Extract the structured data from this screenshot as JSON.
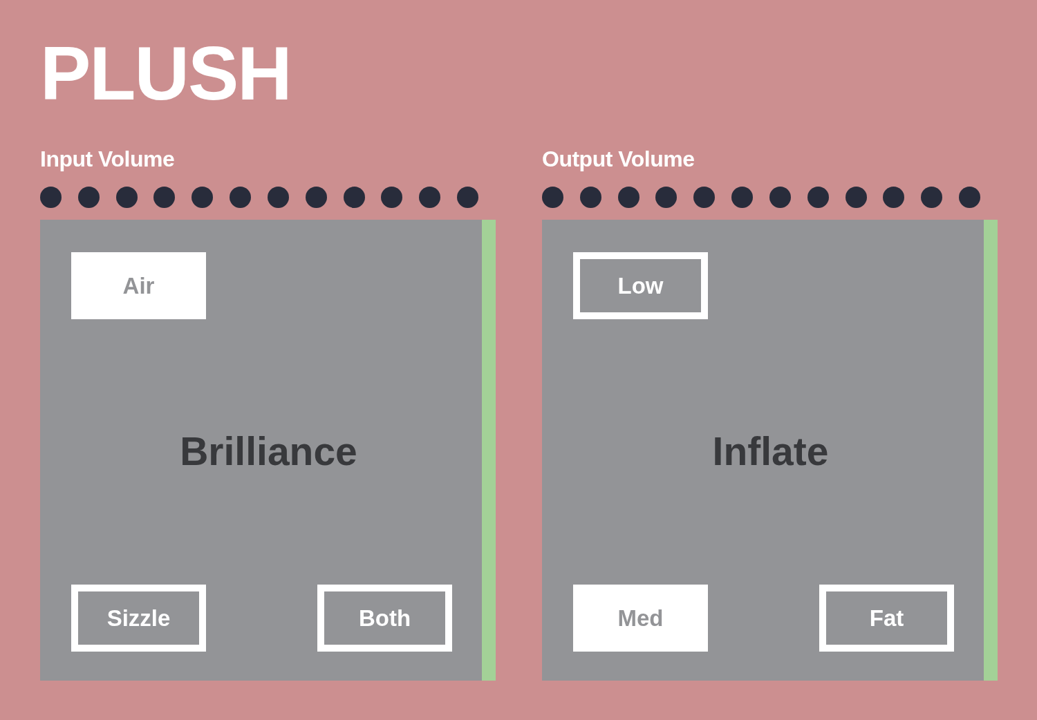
{
  "app_title": "PLUSH",
  "sections": [
    {
      "label": "Input Volume",
      "panel": {
        "title": "Brilliance",
        "top_options": [
          {
            "label": "Air",
            "selected": true
          }
        ],
        "bottom_options": [
          {
            "label": "Sizzle",
            "selected": false
          },
          {
            "label": "Both",
            "selected": false
          }
        ]
      }
    },
    {
      "label": "Output Volume",
      "panel": {
        "title": "Inflate",
        "top_options": [
          {
            "label": "Low",
            "selected": false
          }
        ],
        "bottom_options": [
          {
            "label": "Med",
            "selected": true
          },
          {
            "label": "Fat",
            "selected": false
          }
        ]
      }
    }
  ]
}
